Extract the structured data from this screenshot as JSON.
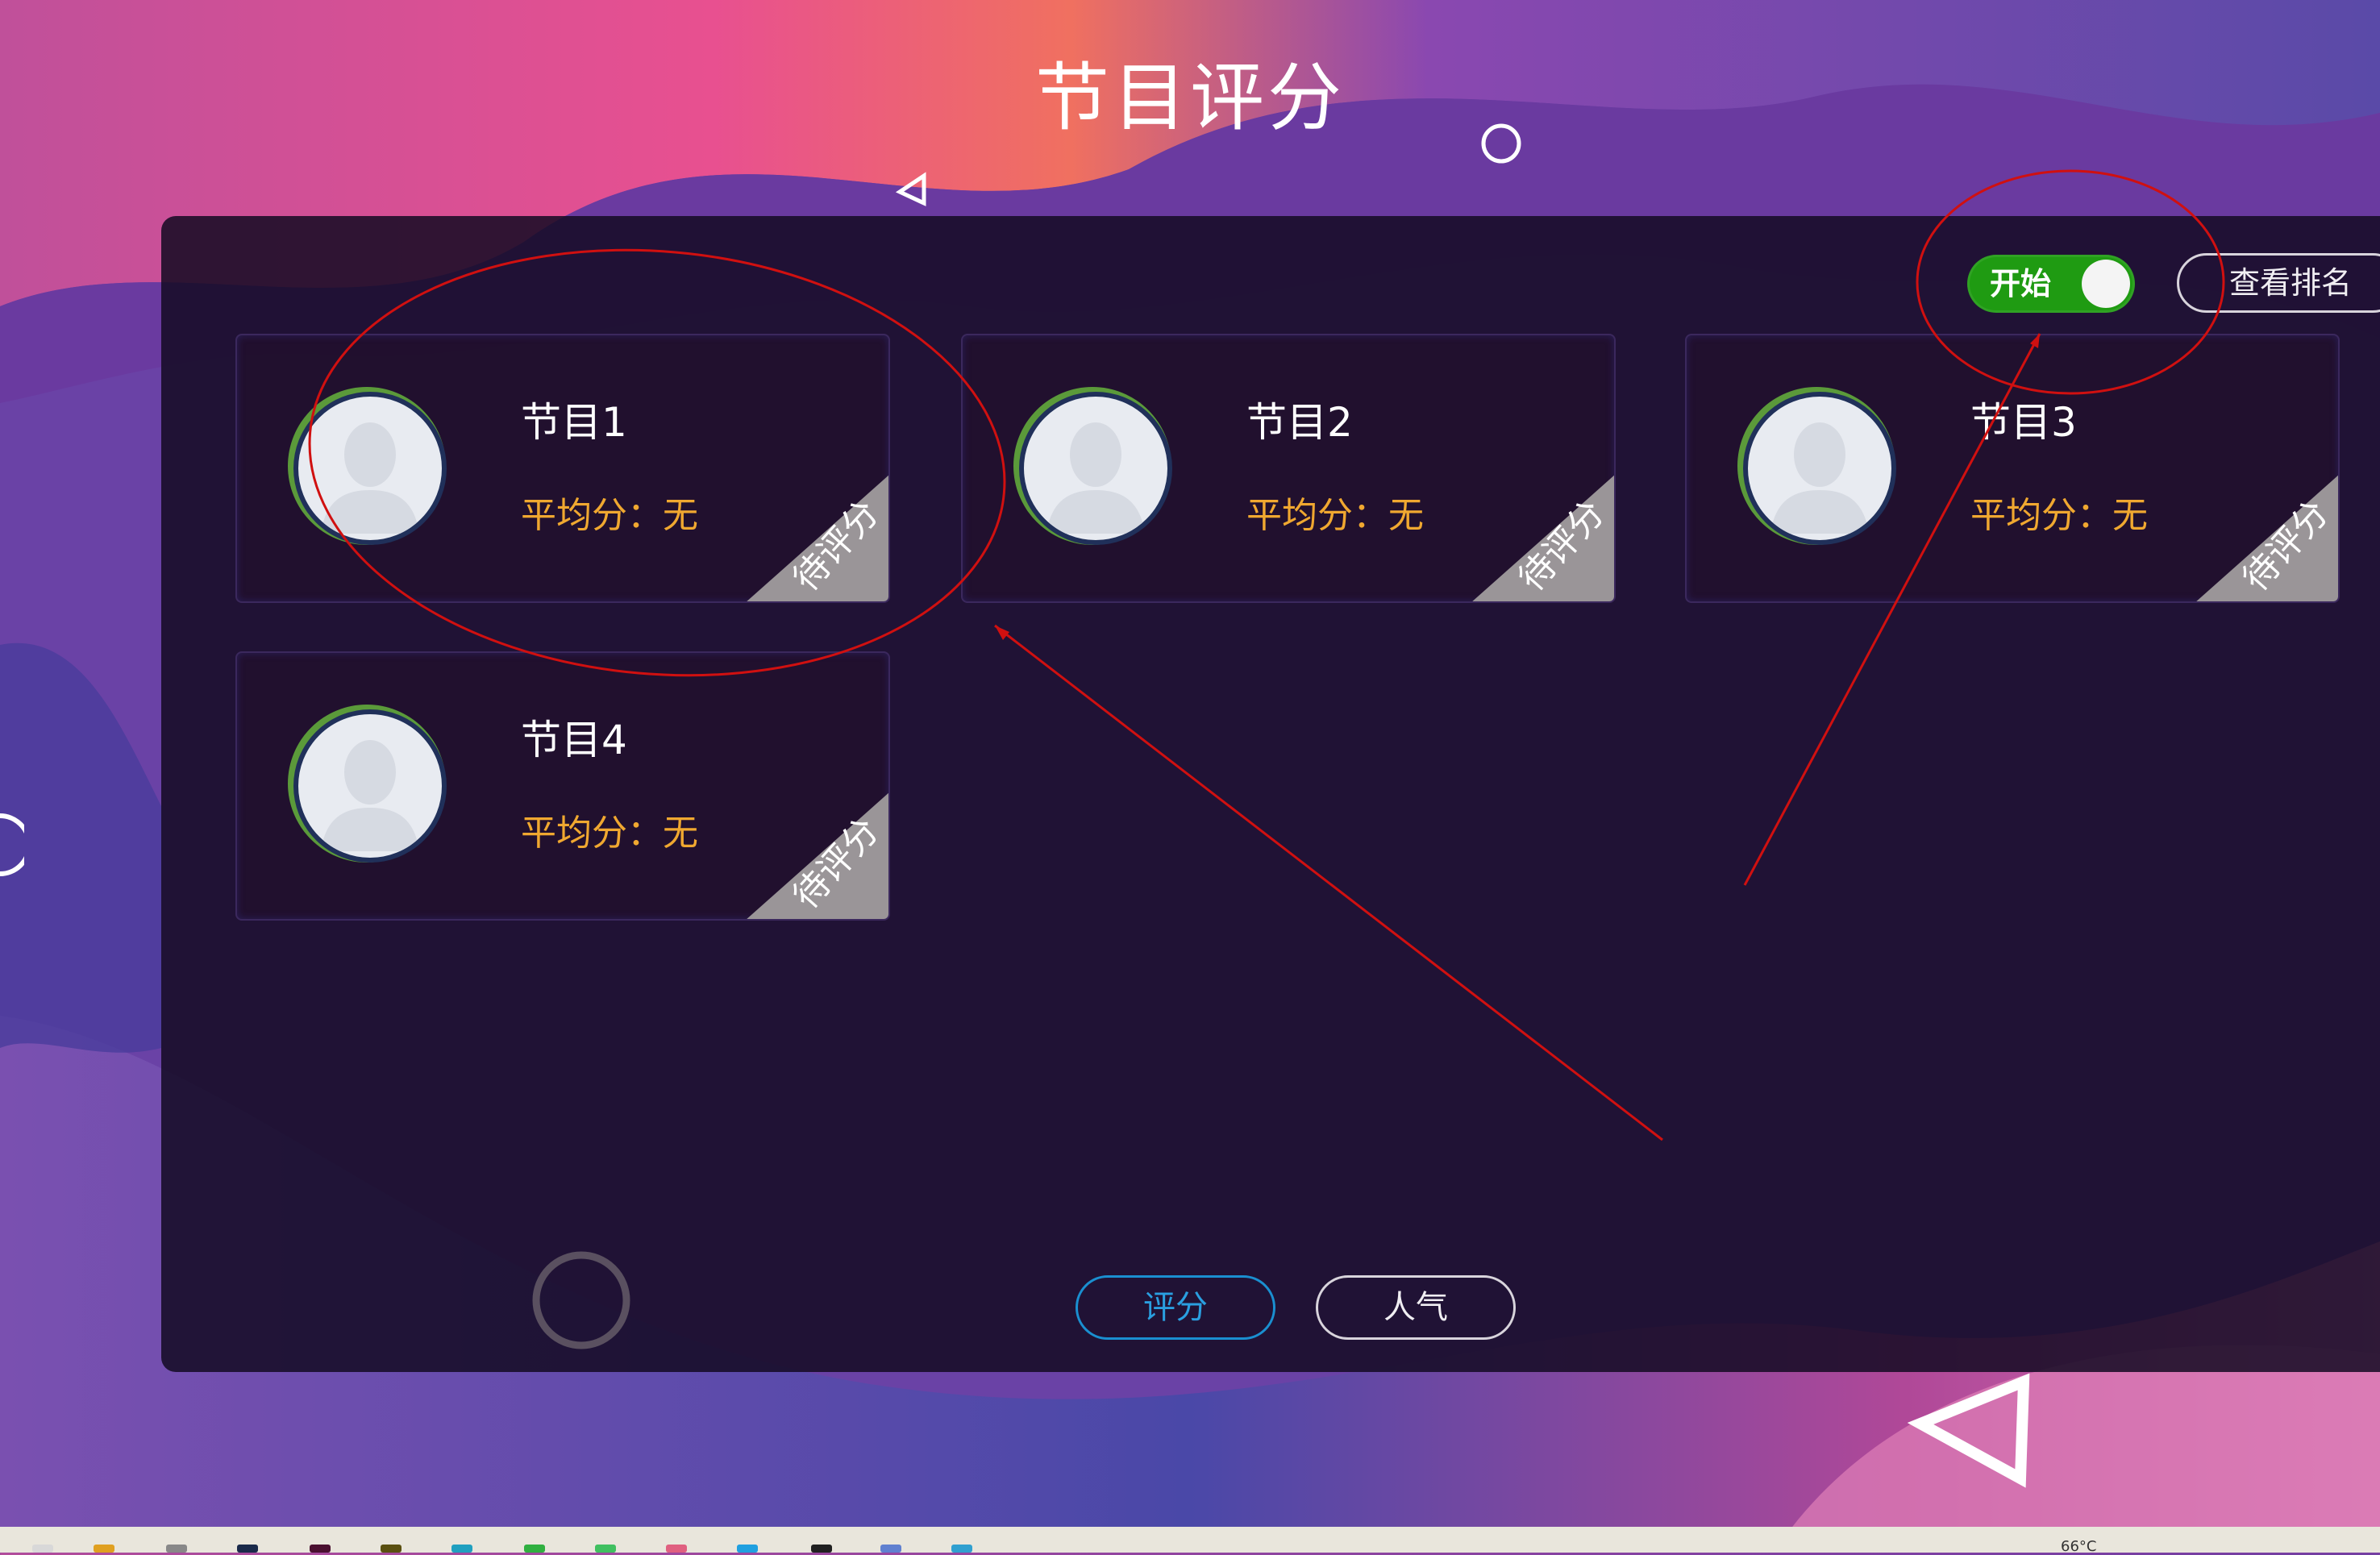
{
  "page": {
    "title": "节目评分"
  },
  "controls": {
    "toggle_label": "开始",
    "toggle_on": true,
    "rank_button": "查看排名"
  },
  "programs": [
    {
      "name": "节目1",
      "score": "平均分：无",
      "status": "待评分"
    },
    {
      "name": "节目2",
      "score": "平均分：无",
      "status": "待评分"
    },
    {
      "name": "节目3",
      "score": "平均分：无",
      "status": "待评分"
    },
    {
      "name": "节目4",
      "score": "平均分：无",
      "status": "待评分"
    }
  ],
  "tabs": [
    {
      "label": "评分",
      "active": true
    },
    {
      "label": "人气",
      "active": false
    }
  ],
  "taskbar": {
    "temperature": "66°C"
  },
  "colors": {
    "accent": "#2a9fe0",
    "toggle": "#1f9b12",
    "score": "#f0a830",
    "annotation": "#d01010"
  }
}
